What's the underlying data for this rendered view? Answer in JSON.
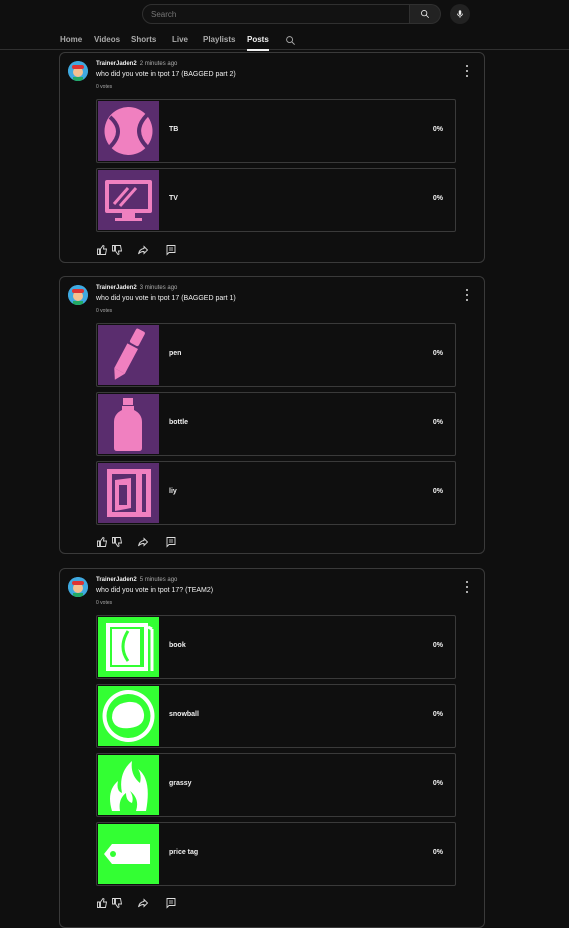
{
  "search": {
    "placeholder": "Search"
  },
  "tabs": [
    {
      "label": "Home"
    },
    {
      "label": "Videos"
    },
    {
      "label": "Shorts"
    },
    {
      "label": "Live"
    },
    {
      "label": "Playlists"
    },
    {
      "label": "Posts",
      "active": true
    }
  ],
  "colors": {
    "purple_bg": "#5a2d6e",
    "pink_icon": "#f080c0",
    "green_bg": "#33ff33",
    "white_icon": "#ffffff"
  },
  "posts": [
    {
      "author": "TrainerJaden2",
      "time": "2 minutes ago",
      "title": "who did you vote in tpot 17 (BAGGED part 2)",
      "votes": "0 votes",
      "options": [
        {
          "label": "TB",
          "percent": "0%",
          "icon": "tennis-ball-icon"
        },
        {
          "label": "TV",
          "percent": "0%",
          "icon": "tv-icon"
        }
      ]
    },
    {
      "author": "TrainerJaden2",
      "time": "3 minutes ago",
      "title": "who did you vote in tpot 17 (BAGGED part 1)",
      "votes": "0 votes",
      "options": [
        {
          "label": "pen",
          "percent": "0%",
          "icon": "pen-icon"
        },
        {
          "label": "bottle",
          "percent": "0%",
          "icon": "bottle-icon"
        },
        {
          "label": "liy",
          "percent": "0%",
          "icon": "liy-icon"
        }
      ]
    },
    {
      "author": "TrainerJaden2",
      "time": "5 minutes ago",
      "title": "who did you vote in tpot 17? (TEAM2)",
      "votes": "0 votes",
      "options": [
        {
          "label": "book",
          "percent": "0%",
          "icon": "book-icon"
        },
        {
          "label": "snowball",
          "percent": "0%",
          "icon": "snowball-icon"
        },
        {
          "label": "grassy",
          "percent": "0%",
          "icon": "grassy-icon"
        },
        {
          "label": "price tag",
          "percent": "0%",
          "icon": "price-tag-icon"
        }
      ]
    }
  ]
}
